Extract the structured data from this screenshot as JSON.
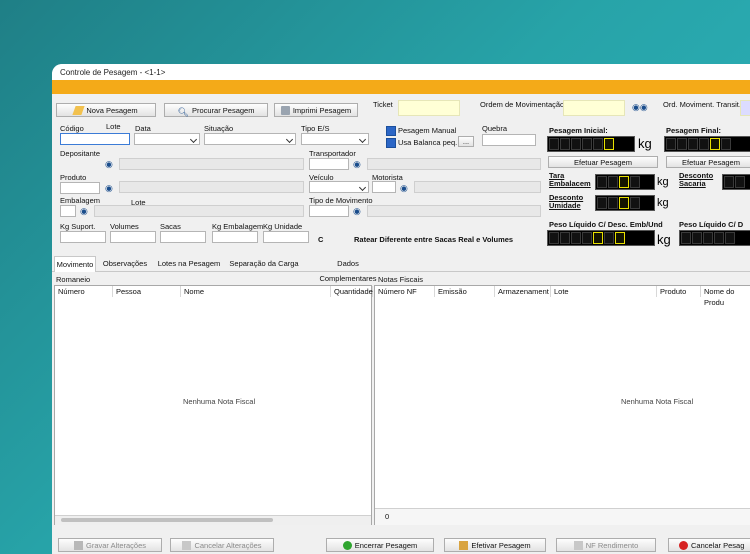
{
  "window": {
    "title": "Controle de Pesagem - <1-1>"
  },
  "toolbar": {
    "new_label": "Nova Pesagem",
    "search_label": "Procurar Pesagem",
    "print_label": "Imprimi Pesagem",
    "ticket_label": "Ticket",
    "ordem_label": "Ordem de Movimentação:",
    "ord_transit_label": "Ord. Moviment. Transit.:"
  },
  "form": {
    "codigo": "Código",
    "lote": "Lote",
    "data": "Data",
    "situacao": "Situação",
    "tipo_es": "Tipo E/S",
    "pesagem_manual": "Pesagem Manual",
    "usa_balanca": "Usa Balanca peq.",
    "ellipsis": "...",
    "quebra": "Quebra",
    "depositante": "Depositante",
    "transportador": "Transportador",
    "produto": "Produto",
    "veiculo": "Veículo",
    "motorista": "Motorista",
    "embalagem": "Embalagem",
    "lote2": "Lote",
    "tipo_movimento": "Tipo  de Movimento",
    "kg_suport": "Kg Suport.",
    "volumes": "Volumes",
    "sacas": "Sacas",
    "kg_embalagem": "Kg Embalagem",
    "kg_unidade": "Kg Unidade",
    "c": "C",
    "ratear": "Ratear Diferente entre Sacas Real e Volumes"
  },
  "weigh": {
    "inicial": "Pesagem Inicial:",
    "final": "Pesagem Final:",
    "kg": "kg",
    "efetuar": "Efetuar Pesagem",
    "tara": "Tara Embalacem",
    "desc_umidade": "Desconto Umidade",
    "desc_sacaria": "Desconto Sacaria",
    "liquido": "Peso Líquido C/ Desc. Emb/Und",
    "liquido2": "Peso Líquido C/ D"
  },
  "tabs": [
    "Movimento",
    "Observações",
    "Lotes na Pesagem",
    "Separação da Carga",
    "Dados Complementares"
  ],
  "romaneio": {
    "title": "Romaneio",
    "columns": [
      "Número",
      "Pessoa",
      "Nome",
      "Quantidade"
    ],
    "empty": "Nenhuma Nota Fiscal"
  },
  "notas": {
    "title": "Notas Fiscais",
    "columns": [
      "Número NF",
      "Emissão",
      "Armazenament",
      "Lote",
      "Produto",
      "Nome do Produ"
    ],
    "empty": "Nenhuma Nota Fiscal",
    "count": "0"
  },
  "footer": {
    "gravar": "Gravar Alterações",
    "cancelar": "Cancelar Alterações",
    "encerrar": "Encerrar Pesagem",
    "efetivar": "Efetivar Pesagem",
    "nf_rendimento": "NF Rendimento",
    "cancelar_pes": "Cancelar Pesag"
  },
  "colors": {
    "accent": "#f4aa18",
    "lcd_on": "#e8e000"
  }
}
